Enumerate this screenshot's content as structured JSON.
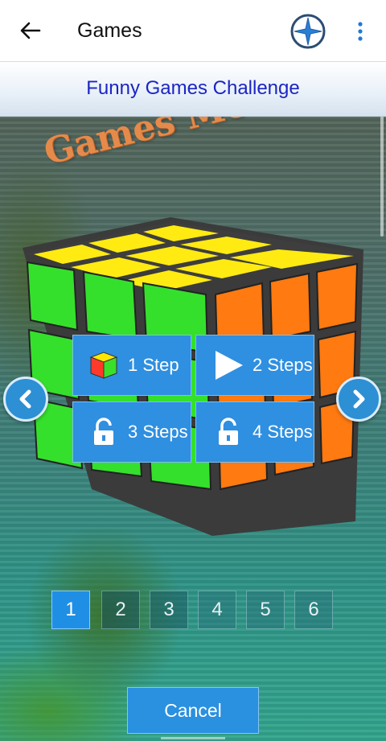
{
  "appbar": {
    "title": "Games",
    "back_icon": "arrow-left-icon",
    "compass_icon": "compass-icon",
    "more_icon": "more-vert-icon"
  },
  "header": {
    "title": "Funny Games Challenge"
  },
  "mode": {
    "title": "Games Mode"
  },
  "steps": [
    {
      "label": "1 Step",
      "icon": "mini-cube-icon"
    },
    {
      "label": "2 Steps",
      "icon": "play-icon"
    },
    {
      "label": "3 Steps",
      "icon": "lock-icon"
    },
    {
      "label": "4 Steps",
      "icon": "lock-icon"
    }
  ],
  "pager": {
    "pages": [
      "1",
      "2",
      "3",
      "4",
      "5",
      "6"
    ],
    "active": "1"
  },
  "cancel_label": "Cancel",
  "colors": {
    "accent": "#2f8fe0",
    "header_title": "#1c25c4",
    "mode_title": "#e58a4a",
    "cube_green": "#33e02a",
    "cube_orange": "#ff7a10",
    "cube_yellow": "#ffec10"
  }
}
